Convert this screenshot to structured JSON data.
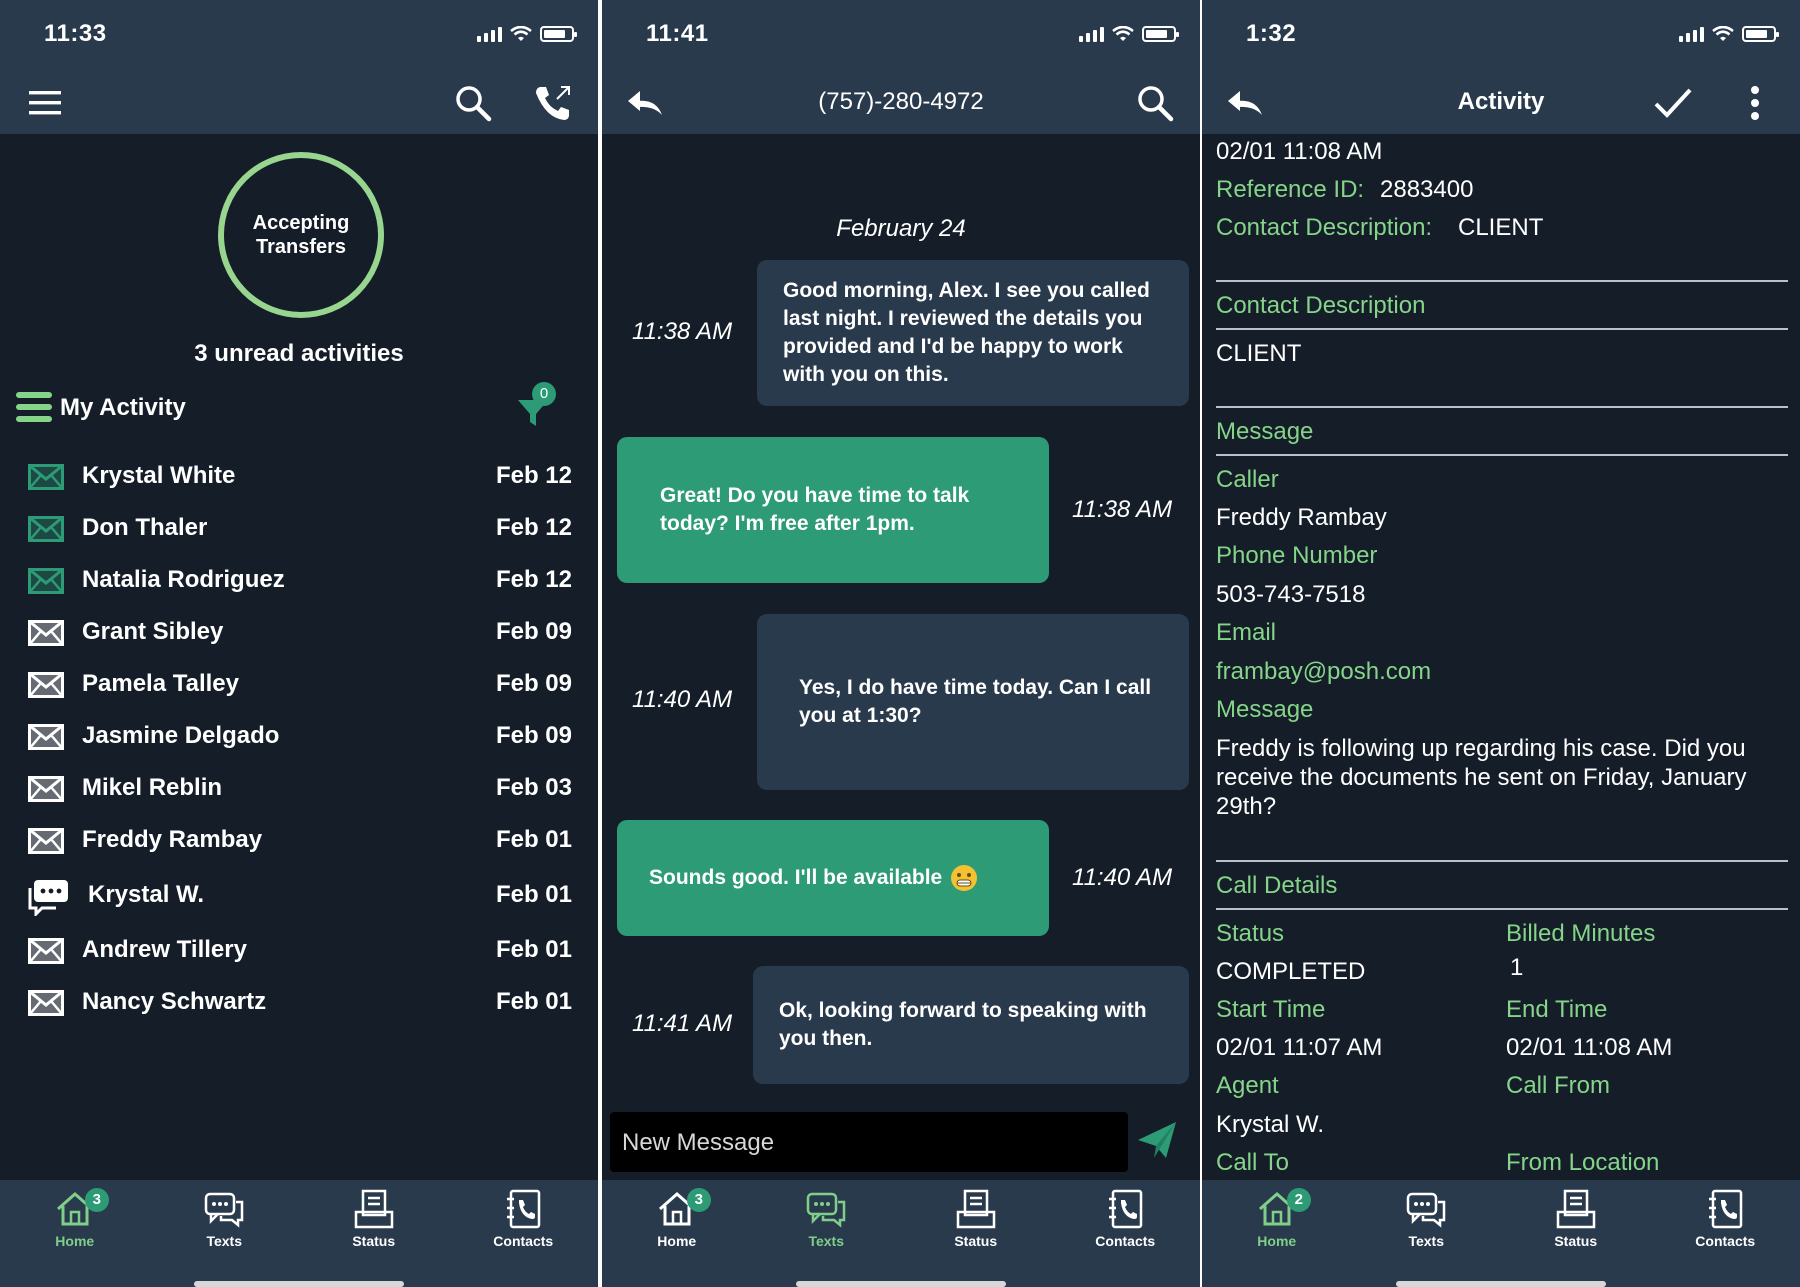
{
  "screens": [
    {
      "time": "11:33",
      "status_circle": "Accepting Transfers",
      "unread_text": "3 unread activities",
      "section_title": "My Activity",
      "filter_count": "0",
      "activities": [
        {
          "type": "email",
          "name": "Krystal White",
          "date": "Feb 12",
          "unread": true
        },
        {
          "type": "email",
          "name": "Don Thaler",
          "date": "Feb 12",
          "unread": true
        },
        {
          "type": "email",
          "name": "Natalia Rodriguez",
          "date": "Feb 12",
          "unread": true
        },
        {
          "type": "email",
          "name": "Grant Sibley",
          "date": "Feb 09",
          "unread": false
        },
        {
          "type": "email",
          "name": "Pamela Talley",
          "date": "Feb 09",
          "unread": false
        },
        {
          "type": "email",
          "name": "Jasmine Delgado",
          "date": "Feb 09",
          "unread": false
        },
        {
          "type": "email",
          "name": "Mikel Reblin",
          "date": "Feb 03",
          "unread": false
        },
        {
          "type": "email",
          "name": "Freddy Rambay",
          "date": "Feb 01",
          "unread": false
        },
        {
          "type": "chat",
          "name": "Krystal W.",
          "date": "Feb 01",
          "unread": false
        },
        {
          "type": "email",
          "name": "Andrew Tillery",
          "date": "Feb 01",
          "unread": false
        },
        {
          "type": "email",
          "name": "Nancy Schwartz",
          "date": "Feb 01",
          "unread": false
        }
      ],
      "tabs": {
        "home": "Home",
        "texts": "Texts",
        "status": "Status",
        "contacts": "Contacts",
        "home_badge": "3"
      }
    },
    {
      "time": "11:41",
      "title": "(757)-280-4972",
      "date_header": "February 24",
      "messages": [
        {
          "dir": "in",
          "time": "11:38 AM",
          "text": "Good morning, Alex. I see you called last night. I reviewed the details you provided and I'd be happy to work with you on this."
        },
        {
          "dir": "out",
          "time": "11:38 AM",
          "text": "Great! Do you have time to talk today? I'm free after 1pm."
        },
        {
          "dir": "in",
          "time": "11:40 AM",
          "text": "Yes, I do have time today. Can I call you at 1:30?"
        },
        {
          "dir": "out",
          "time": "11:40 AM",
          "text": "Sounds good. I'll be available"
        },
        {
          "dir": "in",
          "time": "11:41 AM",
          "text": "Ok, looking forward to speaking with you then."
        }
      ],
      "compose_placeholder": "New Message",
      "tabs": {
        "home": "Home",
        "texts": "Texts",
        "status": "Status",
        "contacts": "Contacts",
        "home_badge": "3"
      }
    },
    {
      "time": "1:32",
      "title": "Activity",
      "datetime": "02/01 11:08 AM",
      "reference_label": "Reference ID:",
      "reference_value": "2883400",
      "contact_desc_label": "Contact Description:",
      "contact_desc_value": "CLIENT",
      "section_contact_desc": "Contact Description",
      "contact_desc_body": "CLIENT",
      "section_message": "Message",
      "caller_label": "Caller",
      "caller_value": "Freddy Rambay",
      "phone_label": "Phone Number",
      "phone_value": "503-743-7518",
      "email_label": "Email",
      "email_value": "frambay@posh.com",
      "message_label": "Message",
      "message_value": "Freddy is following up regarding his case. Did you receive the documents he sent on Friday, January 29th?",
      "section_call_details": "Call Details",
      "status_label": "Status",
      "status_value": "COMPLETED",
      "billed_label": "Billed Minutes",
      "billed_value": "1",
      "start_label": "Start Time",
      "start_value": "02/01 11:07 AM",
      "end_label": "End Time",
      "end_value": "02/01 11:08 AM",
      "agent_label": "Agent",
      "agent_value": "Krystal W.",
      "callfrom_label": "Call From",
      "callto_label": "Call To",
      "fromloc_label": "From Location",
      "tabs": {
        "home": "Home",
        "texts": "Texts",
        "status": "Status",
        "contacts": "Contacts",
        "home_badge": "2"
      }
    }
  ],
  "colors": {
    "bg": "#141d28",
    "bar": "#2a3a4d",
    "accent": "#2d9b75",
    "green_text": "#86d48a",
    "ring": "#98d58f"
  },
  "icons": [
    "menu-icon",
    "search-icon",
    "phone-transfer-icon",
    "back-icon",
    "check-icon",
    "more-vert-icon",
    "envelope-icon",
    "chat-icon",
    "filter-icon",
    "list-icon",
    "home-icon",
    "texts-icon",
    "status-icon",
    "contacts-icon",
    "send-icon"
  ]
}
